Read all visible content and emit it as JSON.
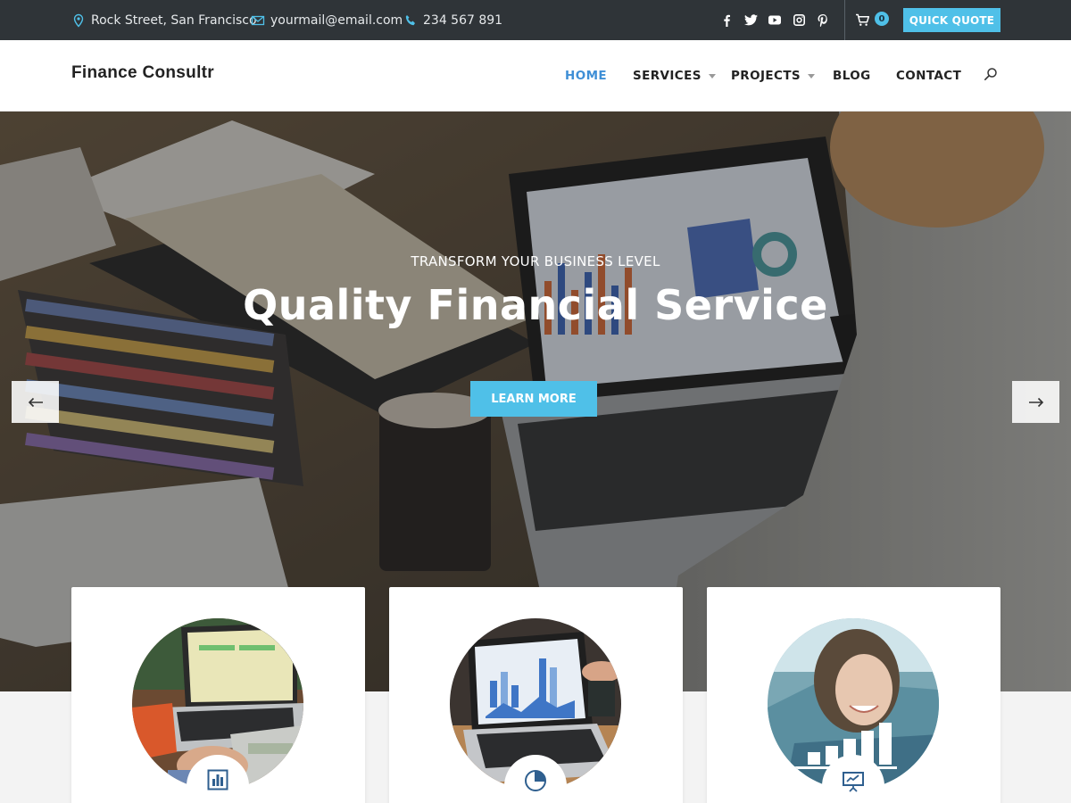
{
  "topbar": {
    "address": "Rock Street, San Francisco",
    "email": "yourmail@email.com",
    "phone": "234 567 891",
    "socials": [
      "facebook-icon",
      "twitter-icon",
      "youtube-icon",
      "instagram-icon",
      "pinterest-icon"
    ],
    "cart_count": "0",
    "quote_label": "QUICK QUOTE"
  },
  "header": {
    "brand": "Finance Consultr",
    "nav": {
      "home": "HOME",
      "services": "SERVICES",
      "projects": "PROJECTS",
      "blog": "BLOG",
      "contact": "CONTACT"
    }
  },
  "hero": {
    "subtitle": "TRANSFORM YOUR BUSINESS LEVEL",
    "title": "Quality Financial Service",
    "button": "LEARN MORE"
  },
  "cards": [
    {
      "icon": "bar-chart-icon",
      "image": "calculator-laptop-photo"
    },
    {
      "icon": "pie-chart-icon",
      "image": "laptop-charts-photo"
    },
    {
      "icon": "presentation-icon",
      "image": "woman-smiling-photo"
    }
  ],
  "colors": {
    "accent": "#4fc0e8",
    "topbar": "#2f3438",
    "active_nav": "#3f8fd6",
    "icon_blue": "#2f5f8f"
  }
}
